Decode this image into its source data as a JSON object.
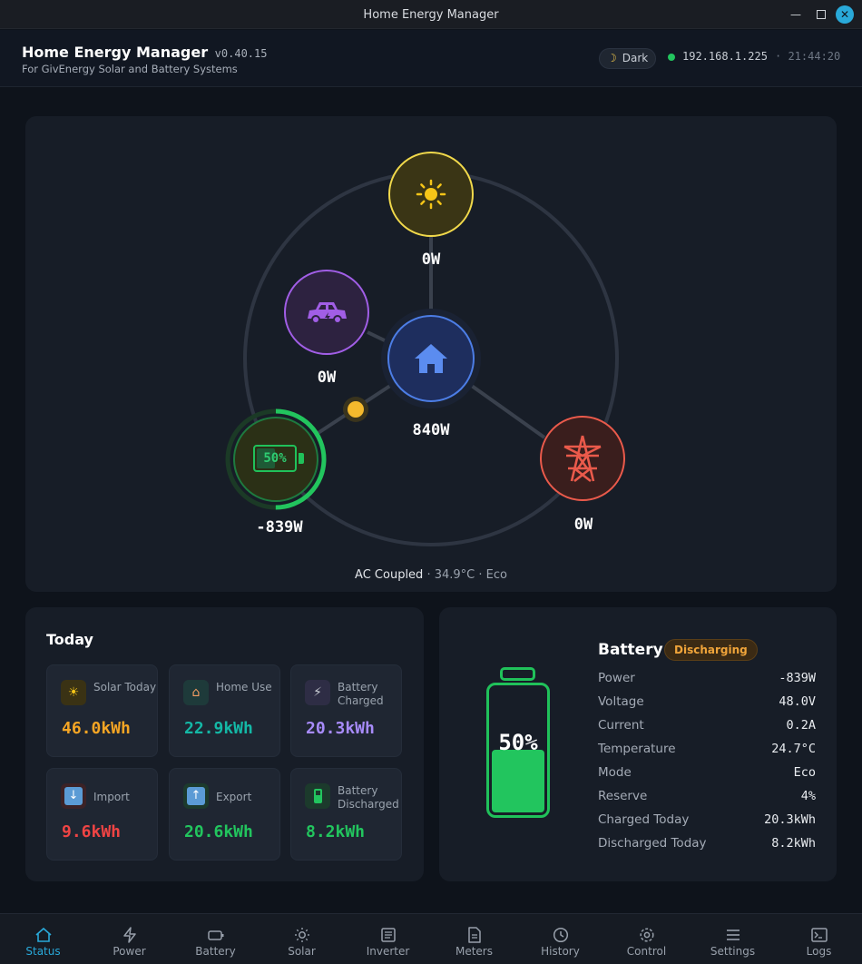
{
  "window": {
    "title": "Home Energy Manager"
  },
  "header": {
    "title": "Home Energy Manager",
    "version": "v0.40.15",
    "subtitle": "For GivEnergy Solar and Battery Systems",
    "theme_label": "Dark",
    "ip": "192.168.1.225",
    "time": "· 21:44:20"
  },
  "flow": {
    "solar_power": "0W",
    "ev_power": "0W",
    "home_power": "840W",
    "battery_power": "-839W",
    "battery_soc_label": "50%",
    "battery_soc": 0.5,
    "grid_power": "0W",
    "inverter_type": "AC Coupled",
    "status_detail": "· 34.9°C · Eco"
  },
  "today": {
    "title": "Today",
    "stats": [
      {
        "label": "Solar Today",
        "value": "46.0kWh",
        "icon": "sun-icon",
        "color": "#f5a524"
      },
      {
        "label": "Home Use",
        "value": "22.9kWh",
        "icon": "house-icon",
        "color": "#14b8a6"
      },
      {
        "label": "Battery Charged",
        "value": "20.3kWh",
        "icon": "plug-icon",
        "color": "#a78bfa"
      },
      {
        "label": "Import",
        "value": "9.6kWh",
        "icon": "down-arrow-icon",
        "color": "#ef4444"
      },
      {
        "label": "Export",
        "value": "20.6kWh",
        "icon": "up-arrow-icon",
        "color": "#22c55e"
      },
      {
        "label": "Battery Discharged",
        "value": "8.2kWh",
        "icon": "battery-icon",
        "color": "#22c55e"
      }
    ]
  },
  "battery": {
    "title": "Battery",
    "status": "Discharging",
    "soc_label": "50%",
    "soc": 0.5,
    "rows": [
      {
        "key": "Power",
        "value": "-839W"
      },
      {
        "key": "Voltage",
        "value": "48.0V"
      },
      {
        "key": "Current",
        "value": "0.2A"
      },
      {
        "key": "Temperature",
        "value": "24.7°C"
      },
      {
        "key": "Mode",
        "value": "Eco"
      },
      {
        "key": "Reserve",
        "value": "4%"
      },
      {
        "key": "Charged Today",
        "value": "20.3kWh"
      },
      {
        "key": "Discharged Today",
        "value": "8.2kWh"
      }
    ]
  },
  "nav": {
    "active": "Status",
    "items": [
      {
        "label": "Status",
        "icon": "home-icon"
      },
      {
        "label": "Power",
        "icon": "bolt-icon"
      },
      {
        "label": "Battery",
        "icon": "battery-icon"
      },
      {
        "label": "Solar",
        "icon": "sun-icon"
      },
      {
        "label": "Inverter",
        "icon": "inverter-icon"
      },
      {
        "label": "Meters",
        "icon": "meter-icon"
      },
      {
        "label": "History",
        "icon": "clock-icon"
      },
      {
        "label": "Control",
        "icon": "gear-icon"
      },
      {
        "label": "Settings",
        "icon": "menu-icon"
      },
      {
        "label": "Logs",
        "icon": "terminal-icon"
      }
    ]
  }
}
